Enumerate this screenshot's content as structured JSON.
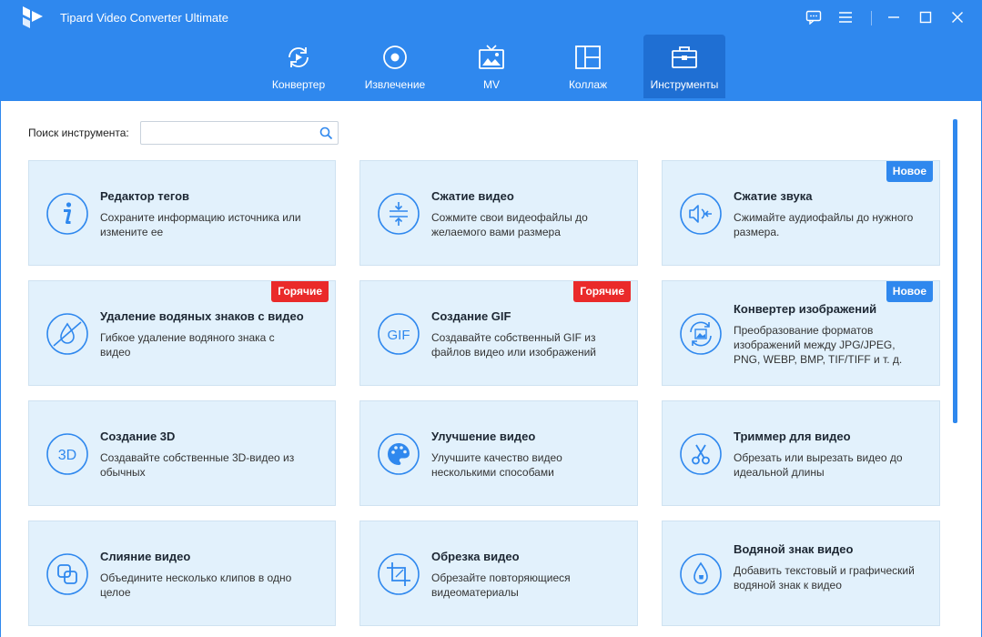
{
  "window": {
    "title": "Tipard Video Converter Ultimate"
  },
  "nav": {
    "tabs": [
      {
        "label": "Конвертер",
        "icon": "convert-icon"
      },
      {
        "label": "Извлечение",
        "icon": "ripper-icon"
      },
      {
        "label": "MV",
        "icon": "mv-icon"
      },
      {
        "label": "Коллаж",
        "icon": "collage-icon"
      },
      {
        "label": "Инструменты",
        "icon": "toolbox-icon",
        "active": true
      }
    ]
  },
  "search": {
    "label": "Поиск инструмента:",
    "value": "",
    "placeholder": ""
  },
  "tools": [
    {
      "title": "Редактор тегов",
      "desc": "Сохраните информацию источника или измените ее",
      "icon": "info-icon",
      "badge": ""
    },
    {
      "title": "Сжатие видео",
      "desc": "Сожмите свои видеофайлы до желаемого вами размера",
      "icon": "compress-icon",
      "badge": ""
    },
    {
      "title": "Сжатие звука",
      "desc": "Сжимайте аудиофайлы до нужного размера.",
      "icon": "audio-compress-icon",
      "badge": "Новое"
    },
    {
      "title": "Удаление водяных знаков с видео",
      "desc": "Гибкое удаление водяного знака с видео",
      "icon": "watermark-remove-icon",
      "badge": "Горячие"
    },
    {
      "title": "Создание GIF",
      "desc": "Создавайте собственный GIF из файлов видео или изображений",
      "icon": "gif-icon",
      "badge": "Горячие"
    },
    {
      "title": "Конвертер изображений",
      "desc": "Преобразование форматов изображений между JPG/JPEG, PNG, WEBP, BMP, TIF/TIFF и т. д.",
      "icon": "image-convert-icon",
      "badge": "Новое"
    },
    {
      "title": "Создание 3D",
      "desc": "Создавайте собственные 3D-видео из обычных",
      "icon": "3d-icon",
      "badge": ""
    },
    {
      "title": "Улучшение видео",
      "desc": "Улучшите качество видео несколькими способами",
      "icon": "palette-icon",
      "badge": ""
    },
    {
      "title": "Триммер для видео",
      "desc": "Обрезать или вырезать видео до идеальной длины",
      "icon": "scissors-icon",
      "badge": ""
    },
    {
      "title": "Слияние видео",
      "desc": "Объедините несколько клипов в одно целое",
      "icon": "merge-icon",
      "badge": ""
    },
    {
      "title": "Обрезка видео",
      "desc": "Обрезайте повторяющиеся видеоматериалы",
      "icon": "crop-icon",
      "badge": ""
    },
    {
      "title": "Водяной знак видео",
      "desc": "Добавить текстовый и графический водяной знак к видео",
      "icon": "watermark-icon",
      "badge": ""
    }
  ],
  "colors": {
    "header": "#2f88ee",
    "active_tab": "#1f6fd3",
    "card_bg": "#e2f1fc",
    "icon": "#2f88ee",
    "badge_new": "#2f88ee",
    "badge_hot": "#ea2a2a"
  }
}
